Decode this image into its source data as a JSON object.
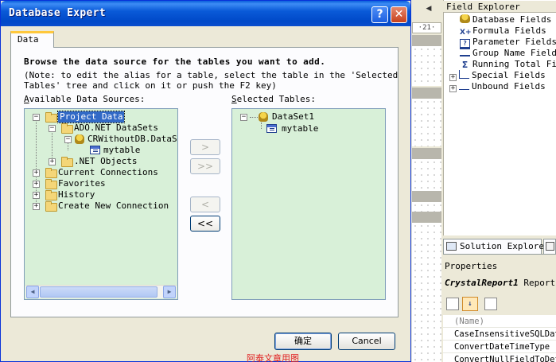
{
  "dialog": {
    "title": "Database Expert",
    "help_glyph": "?",
    "close_glyph": "✕",
    "tab_label": "Data",
    "instruction": "Browse the data source for the tables you want to add.",
    "note": "(Note: to edit the alias for a table, select the table in the 'Selected\nTables' tree and click on it or push the F2 key)",
    "available_label_prefix": "A",
    "available_label_rest": "vailable Data Sources:",
    "selected_label_prefix": "S",
    "selected_label_rest": "elected Tables:",
    "available_tree": [
      {
        "label": "Project Data",
        "expander": "−",
        "selected": true
      },
      {
        "label": "ADO.NET DataSets",
        "expander": "−"
      },
      {
        "label": "CRWithoutDB.DataSet",
        "expander": "−"
      },
      {
        "label": "mytable",
        "expander": ""
      },
      {
        "label": ".NET Objects",
        "expander": "+"
      },
      {
        "label": "Current Connections",
        "expander": "+"
      },
      {
        "label": "Favorites",
        "expander": "+"
      },
      {
        "label": "History",
        "expander": "+"
      },
      {
        "label": "Create New Connection",
        "expander": "+"
      }
    ],
    "selected_tree": [
      {
        "label": "DataSet1",
        "expander": "−"
      },
      {
        "label": "mytable",
        "expander": ""
      }
    ],
    "transfer_buttons": [
      {
        "label": ">",
        "enabled": false
      },
      {
        "label": ">>",
        "enabled": false
      },
      {
        "label": "<",
        "enabled": false
      },
      {
        "label": "<<",
        "enabled": true
      }
    ],
    "ok_label": "确定",
    "cancel_label": "Cancel"
  },
  "ide": {
    "toolbar_text": "·21·",
    "field_explorer": {
      "title": "Field Explorer",
      "items": [
        {
          "label": "Database Fields",
          "expander": ""
        },
        {
          "label": "Formula Fields",
          "expander": ""
        },
        {
          "label": "Parameter Fields",
          "expander": ""
        },
        {
          "label": "Group Name Fields",
          "expander": ""
        },
        {
          "label": "Running Total Fields",
          "expander": ""
        },
        {
          "label": "Special Fields",
          "expander": "+"
        },
        {
          "label": "Unbound Fields",
          "expander": "+"
        }
      ]
    },
    "solution_explorer_tab": "Solution Explorer",
    "properties": {
      "title": "Properties",
      "object_name": "CrystalReport1",
      "object_type": "Report",
      "rows": [
        "(Name)",
        "CaseInsensitiveSQLData",
        "ConvertDateTimeType",
        "ConvertNullFieldToDefault"
      ]
    }
  },
  "watermark": "阿泰文章用图",
  "colors": {
    "title_bar": "#0a5ad8",
    "tree_background": "#d8f0d8",
    "selection": "#3169c6",
    "watermark": "#e02020"
  }
}
